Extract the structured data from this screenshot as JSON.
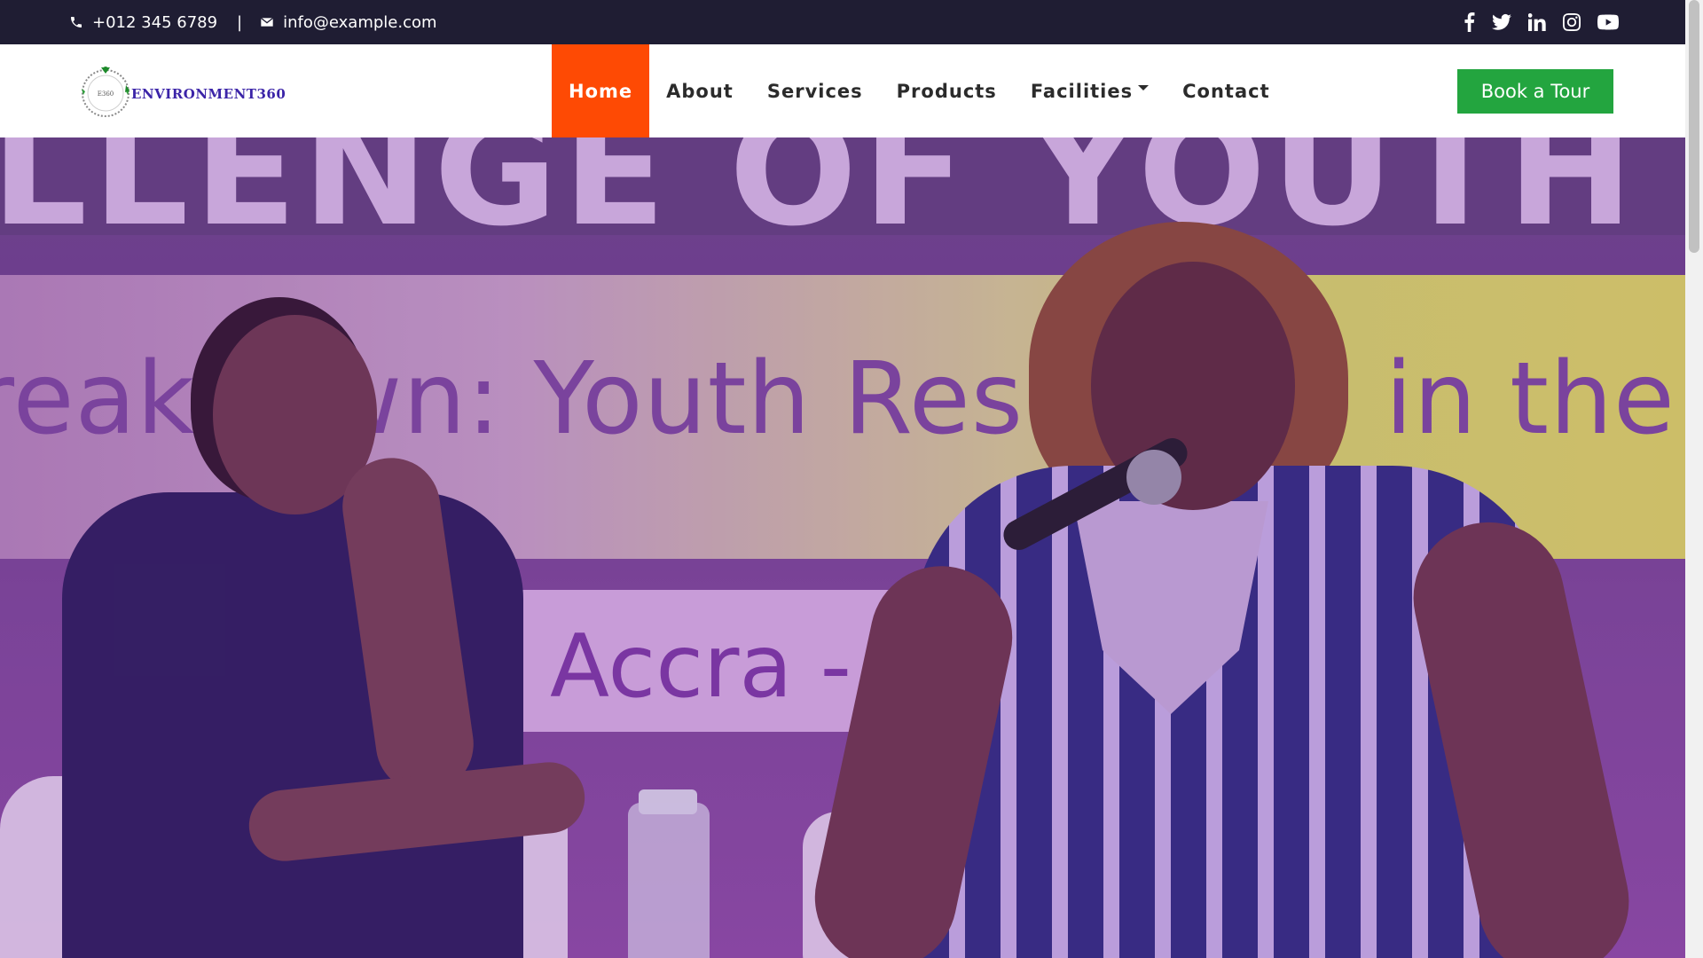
{
  "topbar": {
    "phone": "+012 345 6789",
    "separator": "|",
    "email": "info@example.com",
    "social_icons": [
      "facebook-icon",
      "twitter-icon",
      "linkedin-icon",
      "instagram-icon",
      "youtube-icon"
    ]
  },
  "navbar": {
    "logo_text": "ENVIRONMENT360",
    "logo_emblem_text": "E360",
    "links": [
      {
        "label": "Home",
        "active": true
      },
      {
        "label": "About"
      },
      {
        "label": "Services"
      },
      {
        "label": "Products"
      },
      {
        "label": "Facilities",
        "dropdown": true
      },
      {
        "label": "Contact"
      }
    ],
    "cta_label": "Book a Tour"
  },
  "hero": {
    "banner_top_text": "LLENGE OF YOUTH ON",
    "banner_middle_text": "reakdown: Youth Resilience in the",
    "banner_lower_text": "Accra - "
  },
  "colors": {
    "topbar_bg": "#1f1d33",
    "nav_active_bg": "#fe4a04",
    "cta_bg": "#23a53f",
    "logo_text": "#3b24a8"
  }
}
